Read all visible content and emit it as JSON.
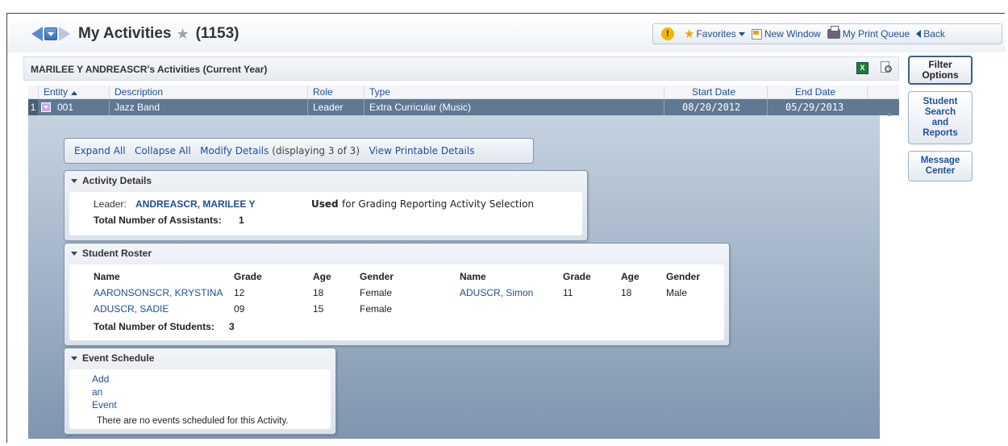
{
  "header": {
    "title": "My Activities",
    "count": "(1153)",
    "toolbar": {
      "favorites": "Favorites",
      "new_window": "New Window",
      "print_queue": "My Print Queue",
      "back": "Back"
    }
  },
  "subheader": {
    "title": "MARILEE Y ANDREASCR's Activities (Current Year)",
    "excel_icon_text": "X"
  },
  "grid": {
    "columns": [
      "Entity",
      "Description",
      "Role",
      "Type",
      "Start Date",
      "End Date"
    ],
    "row": {
      "num": "1",
      "entity": "001",
      "description": "Jazz Band",
      "role": "Leader",
      "type": "Extra Curricular (Music)",
      "start_date": "08/20/2012",
      "end_date": "05/29/2013"
    }
  },
  "actions": {
    "expand_all": "Expand All",
    "collapse_all": "Collapse All",
    "modify_details": "Modify Details",
    "displaying": "(displaying 3 of 3)",
    "view_printable": "View Printable Details"
  },
  "activity_details": {
    "title": "Activity Details",
    "leader_label": "Leader:",
    "leader_name": "ANDREASCR, MARILEE Y",
    "used_bold": "Used",
    "used_text": "for Grading Reporting Activity Selection",
    "assistants_label": "Total Number of Assistants:",
    "assistants_count": "1"
  },
  "student_roster": {
    "title": "Student Roster",
    "headers": {
      "name": "Name",
      "grade": "Grade",
      "age": "Age",
      "gender": "Gender"
    },
    "students": [
      {
        "name": "AARONSONSCR, KRYSTINA",
        "grade": "12",
        "age": "18",
        "gender": "Female"
      },
      {
        "name": "ADUSCR, Simon",
        "grade": "11",
        "age": "18",
        "gender": "Male"
      },
      {
        "name": "ADUSCR, SADIE",
        "grade": "09",
        "age": "15",
        "gender": "Female"
      }
    ],
    "total_label": "Total Number of Students:",
    "total_count": "3"
  },
  "event_schedule": {
    "title": "Event Schedule",
    "add_line1": "Add",
    "add_line2": "an",
    "add_line3": "Event",
    "empty_text": "There are no events scheduled for this Activity."
  },
  "side_buttons": {
    "filter_line1": "Filter",
    "filter_line2": "Options",
    "student_line1": "Student",
    "student_line2": "Search",
    "student_line3": "and",
    "student_line4": "Reports",
    "message_line1": "Message",
    "message_line2": "Center"
  }
}
